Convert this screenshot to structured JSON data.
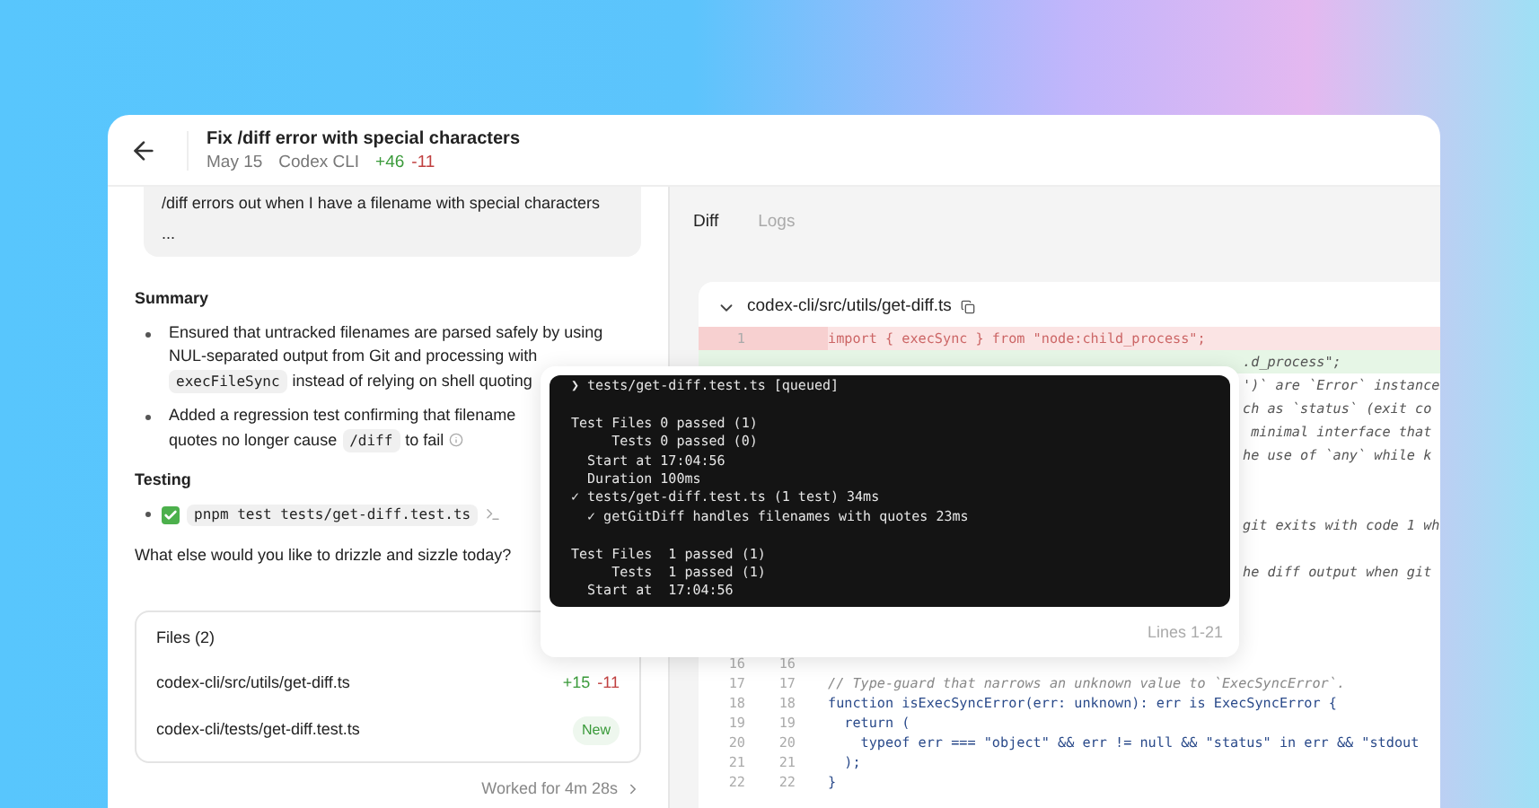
{
  "header": {
    "title": "Fix /diff error with special characters",
    "date": "May 15",
    "source": "Codex CLI",
    "added": "+46",
    "removed": "-11"
  },
  "message": {
    "text": "/diff errors out when I have a filename with special characters",
    "more": "..."
  },
  "summary": {
    "heading": "Summary",
    "bullets": [
      {
        "lines": [
          [
            {
              "kind": "text",
              "text": "Ensured that untracked filenames are parsed safely by using"
            }
          ],
          [
            {
              "kind": "text",
              "text": "NUL-separated output from Git and processing with"
            }
          ],
          [
            {
              "kind": "code",
              "text": "execFileSync"
            },
            {
              "kind": "text",
              "text": "instead of relying on shell quoting"
            }
          ]
        ]
      },
      {
        "lines": [
          [
            {
              "kind": "text",
              "text": "Added a regression test confirming that filename"
            }
          ],
          [
            {
              "kind": "text",
              "text": "quotes no longer cause"
            },
            {
              "kind": "code",
              "text": "/diff"
            },
            {
              "kind": "text",
              "text": "to fail"
            },
            {
              "kind": "info"
            }
          ]
        ]
      }
    ]
  },
  "testing": {
    "heading": "Testing",
    "items": [
      {
        "checked": true,
        "command": "pnpm test tests/get-diff.test.ts"
      }
    ]
  },
  "question": "What else would you like to drizzle and sizzle today?",
  "files": {
    "title": "Files (2)",
    "rows": [
      {
        "path": "codex-cli/src/utils/get-diff.ts",
        "kind": "counts",
        "added": "+15",
        "removed": "-11"
      },
      {
        "path": "codex-cli/tests/get-diff.test.ts",
        "kind": "new",
        "badge": "New"
      }
    ]
  },
  "worked": "Worked for 4m 28s",
  "tabs": [
    {
      "label": "Diff",
      "selected": true
    },
    {
      "label": "Logs",
      "selected": false
    }
  ],
  "diff": {
    "file": "codex-cli/src/utils/get-diff.ts",
    "expanded": true,
    "lines": [
      {
        "kind": "del",
        "old": "1",
        "text": "import { execSync } from \"node:child_process\";"
      },
      {
        "kind": "fragment",
        "add": true,
        "text": ".d_process\";"
      },
      {
        "kind": "fragment",
        "add": false,
        "text": "')` are `Error` instance"
      },
      {
        "kind": "fragment",
        "add": false,
        "text": "ch as `status` (exit co"
      },
      {
        "kind": "fragment",
        "add": false,
        "text": " minimal interface that"
      },
      {
        "kind": "fragment",
        "add": false,
        "text": "he use of `any` while k"
      },
      {
        "kind": "hidden"
      },
      {
        "kind": "hidden"
      },
      {
        "kind": "fragment",
        "add": false,
        "text": "git exits with code 1 wh"
      },
      {
        "kind": "hidden"
      },
      {
        "kind": "fragment",
        "add": false,
        "text": "he diff output when git"
      },
      {
        "kind": "hidden"
      },
      {
        "kind": "hidden"
      },
      {
        "kind": "hidden"
      },
      {
        "kind": "ctx",
        "old": "16",
        "new": "16"
      },
      {
        "kind": "comment",
        "old": "17",
        "new": "17",
        "text": "// Type-guard that narrows an unknown value to `ExecSyncError`."
      },
      {
        "kind": "ctx",
        "old": "18",
        "new": "18",
        "text": "function isExecSyncError(err: unknown): err is ExecSyncError {"
      },
      {
        "kind": "ctx",
        "old": "19",
        "new": "19",
        "text": "  return ("
      },
      {
        "kind": "ctx",
        "old": "20",
        "new": "20",
        "text": "    typeof err === \"object\" && err != null && \"status\" in err && \"stdout"
      },
      {
        "kind": "ctx",
        "old": "21",
        "new": "21",
        "text": "  );"
      },
      {
        "kind": "ctx",
        "old": "22",
        "new": "22",
        "text": "}"
      }
    ]
  },
  "terminal": {
    "blocks": [
      [
        "❯ tests/get-diff.test.ts [queued]"
      ],
      [
        "Test Files 0 passed (1)",
        "     Tests 0 passed (0)",
        "  Start at 17:04:56",
        "  Duration 100ms",
        "✓ tests/get-diff.test.ts (1 test) 34ms",
        "  ✓ getGitDiff handles filenames with quotes 23ms"
      ],
      [
        "Test Files  1 passed (1)",
        "     Tests  1 passed (1)",
        "  Start at  17:04:56"
      ]
    ],
    "range": "Lines 1-21"
  }
}
